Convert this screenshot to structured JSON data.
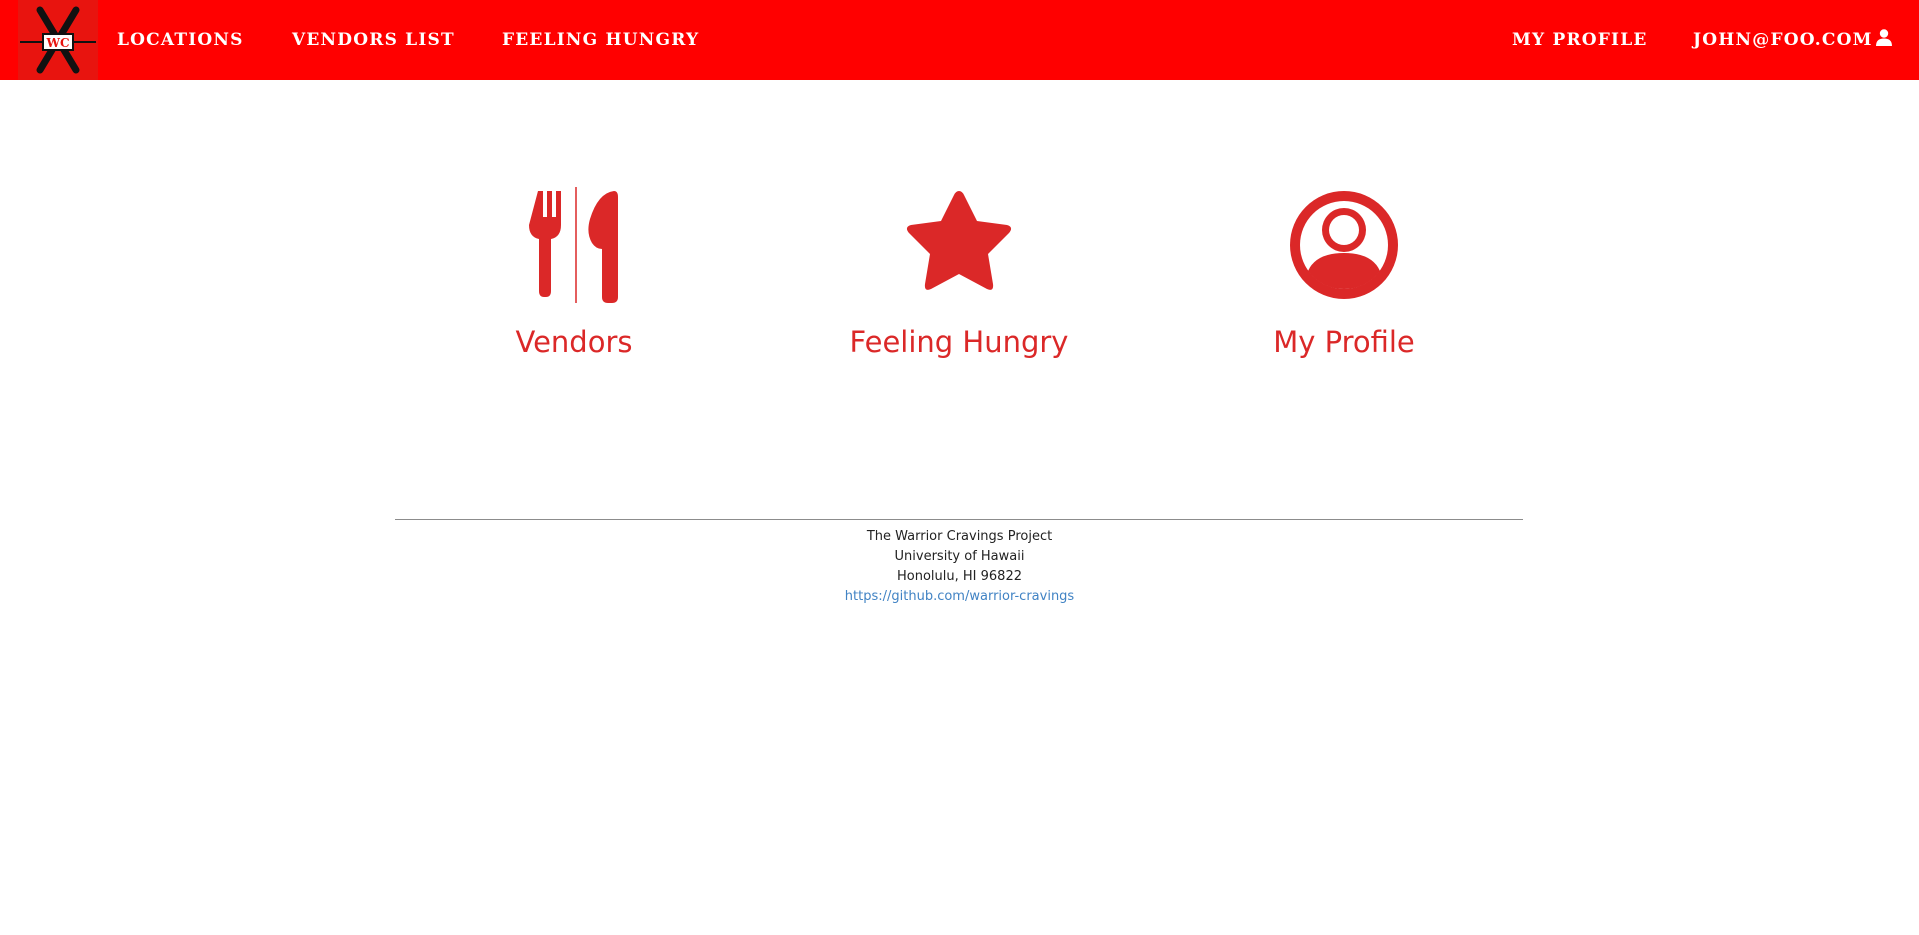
{
  "navbar": {
    "logo": {
      "text": "WC",
      "icon": "warrior-cravings-logo",
      "color": "#ff0000"
    },
    "left_links": [
      "LOCATIONS",
      "VENDORS LIST",
      "FEELING HUNGRY"
    ],
    "right_links": [
      "MY PROFILE"
    ],
    "user_label": "JOHN@FOO.COM",
    "user_icon": "user-icon"
  },
  "tiles": [
    {
      "label": "Vendors",
      "icon": "utensils-icon"
    },
    {
      "label": "Feeling Hungry",
      "icon": "star-icon"
    },
    {
      "label": "My Profile",
      "icon": "user-circle-icon"
    }
  ],
  "theme": {
    "accent": "#db2828",
    "navbar": "#ff0000",
    "link": "#4183c4"
  },
  "footer": {
    "line1": "The Warrior Cravings Project",
    "line2": "University of Hawaii",
    "line3": "Honolulu, HI 96822",
    "link": "https://github.com/warrior-cravings"
  }
}
